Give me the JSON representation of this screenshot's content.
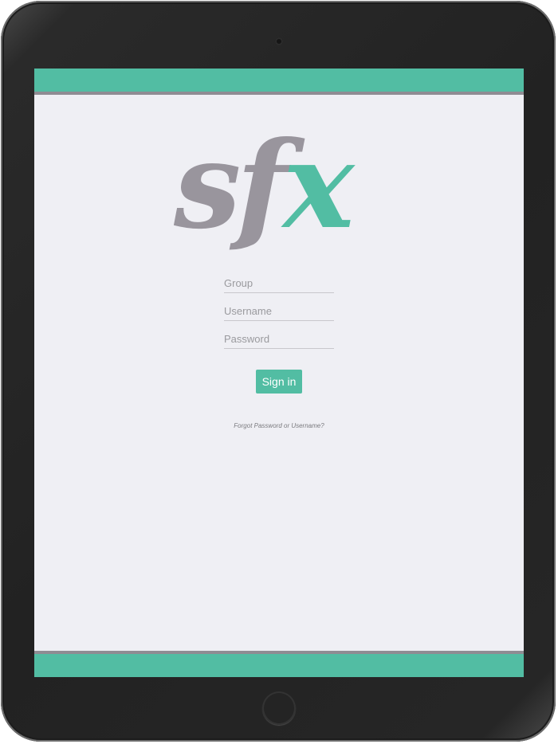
{
  "device": {
    "camera_icon": "front-camera-icon",
    "home_button_icon": "home-button-icon"
  },
  "colors": {
    "accent": "#52bda3",
    "divider": "#8f8c93",
    "logo_gray": "#99959d",
    "background": "#efeff4"
  },
  "logo": {
    "text_gray": "sf",
    "text_accent": "x"
  },
  "form": {
    "group": {
      "value": "",
      "placeholder": "Group"
    },
    "username": {
      "value": "",
      "placeholder": "Username"
    },
    "password": {
      "value": "",
      "placeholder": "Password"
    },
    "signin_label": "Sign in",
    "forgot_label": "Forgot Password or Username?"
  }
}
